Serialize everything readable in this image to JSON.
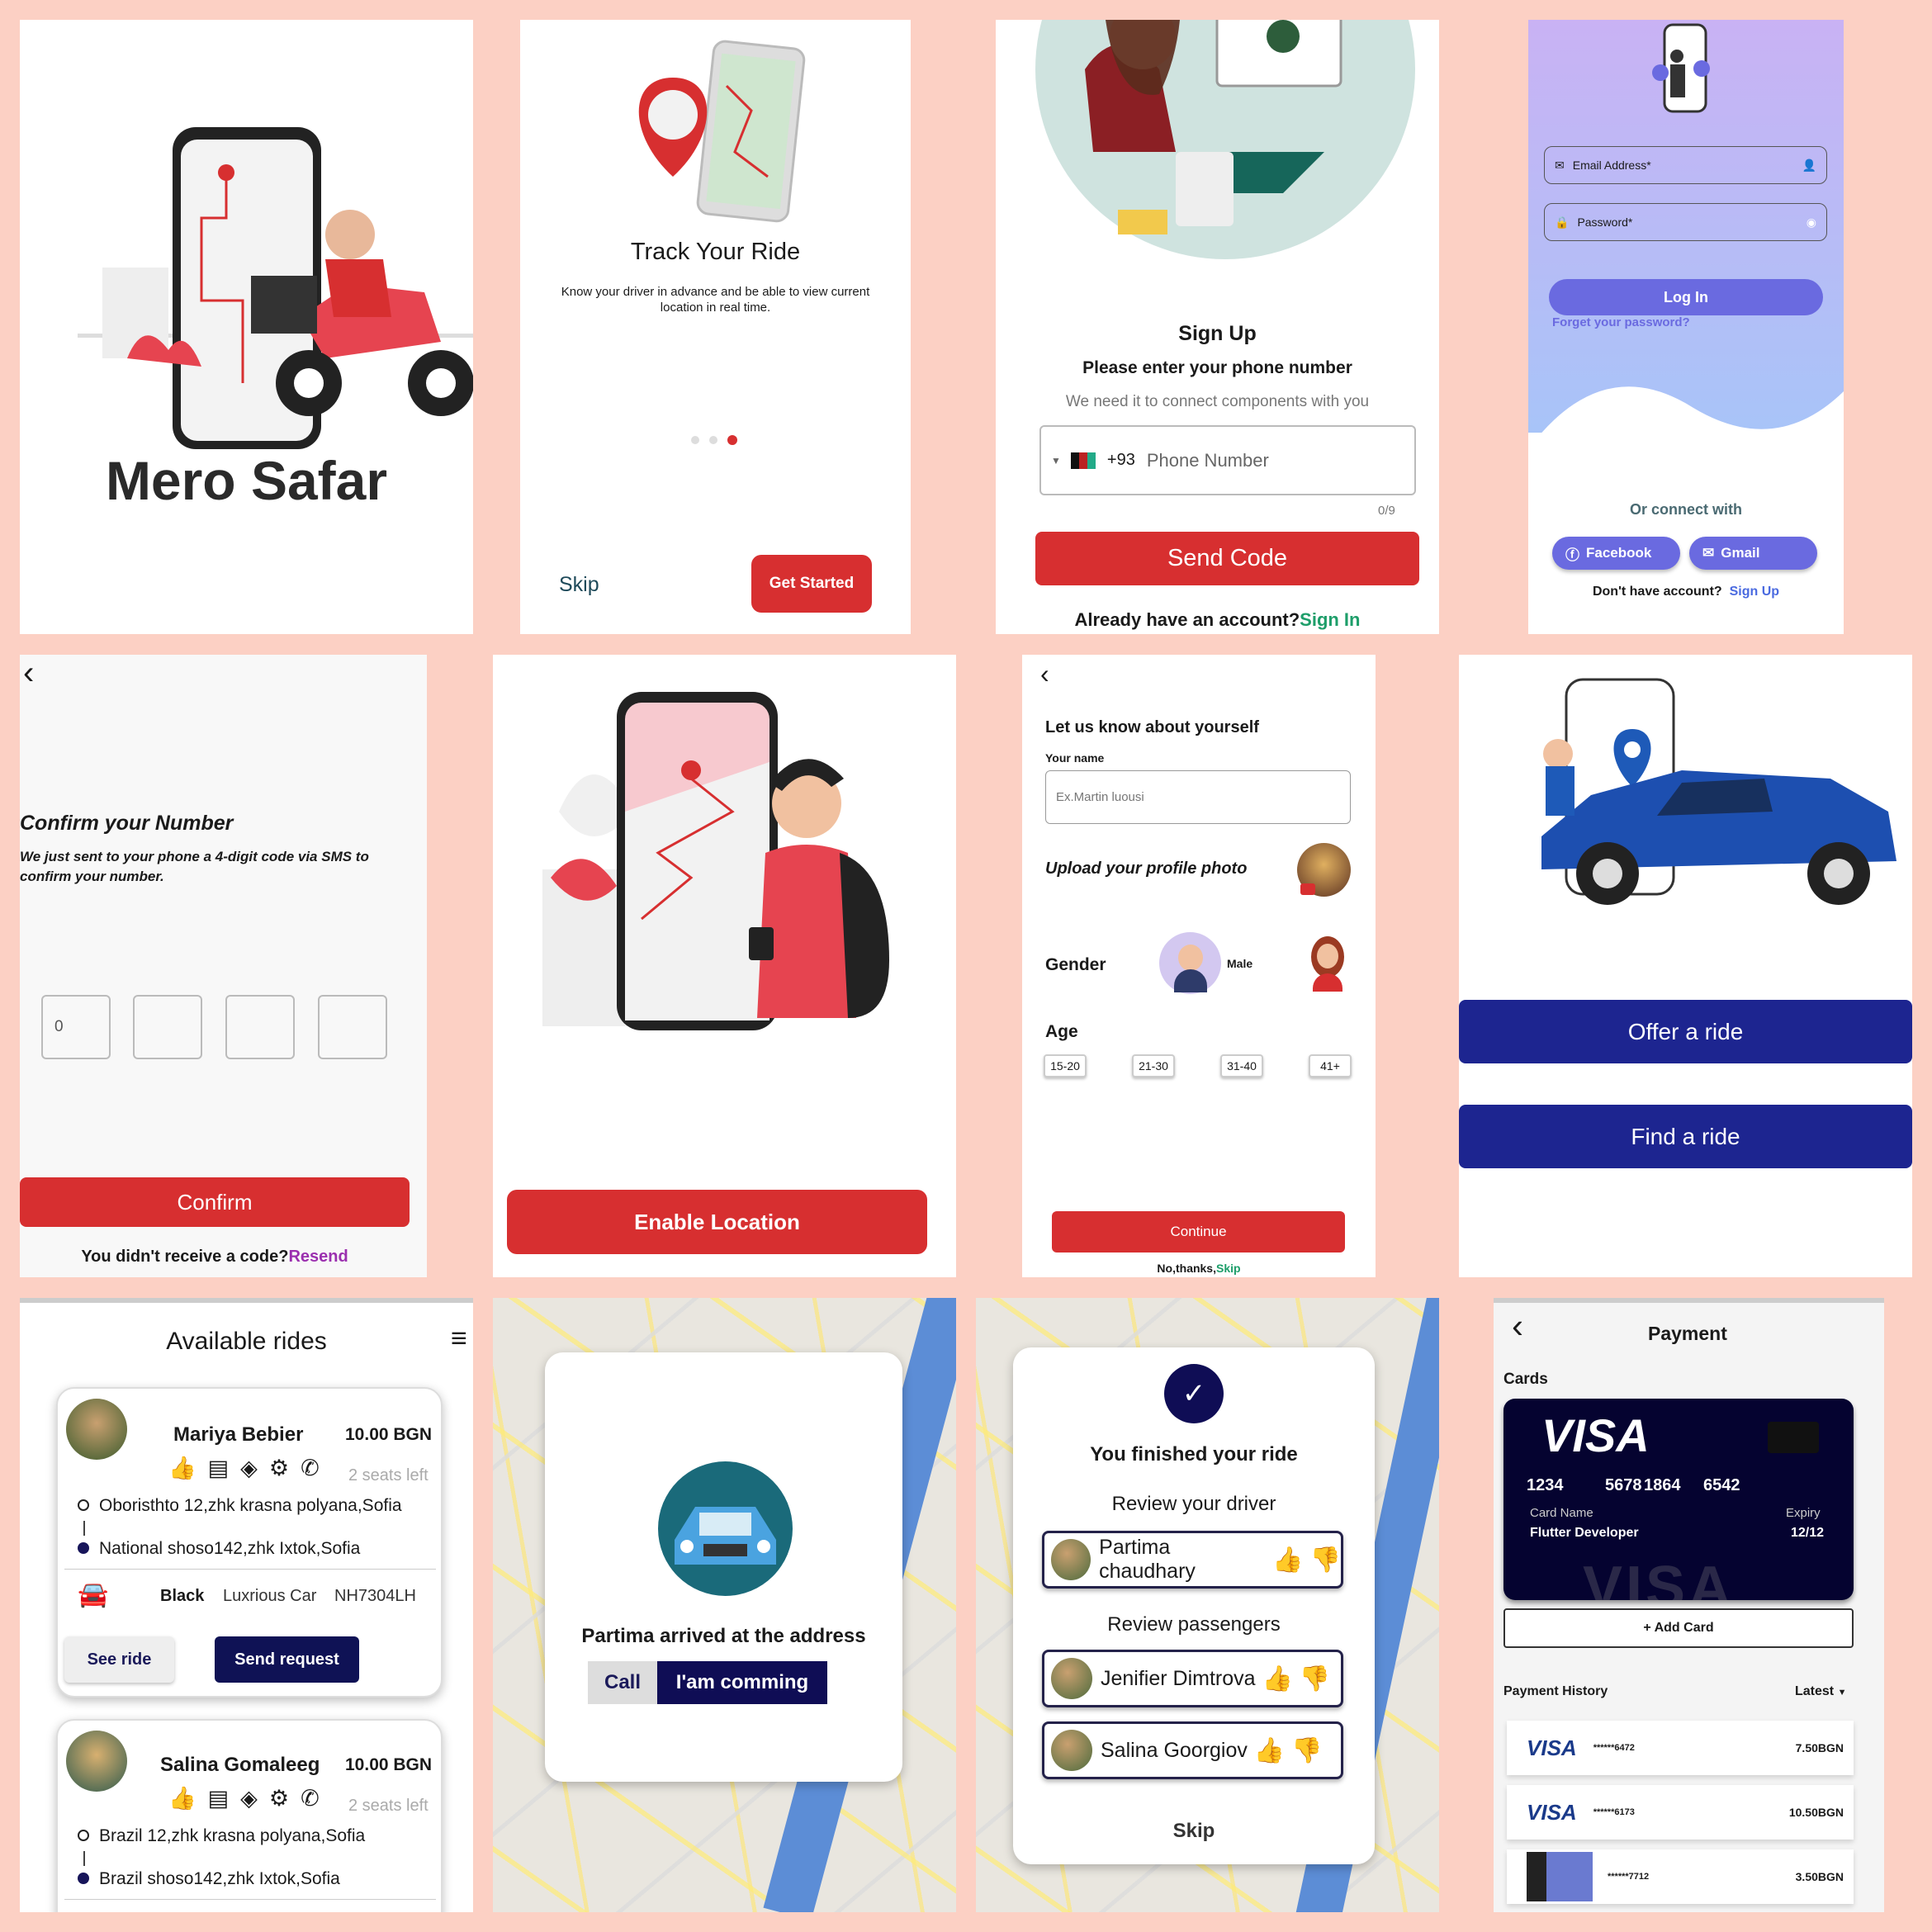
{
  "s1": {
    "title": "Mero Safar"
  },
  "s2": {
    "title": "Track Your Ride",
    "desc": "Know your driver in advance and be able to view current location in real time.",
    "skip": "Skip",
    "get_started": "Get Started"
  },
  "s3": {
    "title": "Sign Up",
    "subtitle": "Please enter your phone number",
    "hint": "We need it to connect components with you",
    "code": "+93",
    "placeholder": "Phone Number",
    "counter": "0/9",
    "send": "Send Code",
    "have_account": "Already have an account?",
    "sign_in": "Sign In"
  },
  "s4": {
    "email": "Email Address*",
    "password": "Password*",
    "login": "Log In",
    "forgot": "Forget your password?",
    "or": "Or connect with",
    "facebook": "Facebook",
    "gmail": "Gmail",
    "no_account": "Don't have account?",
    "signup": "Sign Up"
  },
  "s5": {
    "back": "‹",
    "title": "Confirm your Number",
    "desc": "We just sent to your phone a 4-digit code via SMS to confirm your number.",
    "digit1": "0",
    "confirm": "Confirm",
    "no_code": "You didn't receive a code?",
    "resend": "Resend"
  },
  "s6": {
    "enable": "Enable Location"
  },
  "s7": {
    "back": "‹",
    "title": "Let us know about yourself",
    "name_label": "Your name",
    "name_placeholder": "Ex.Martin luousi",
    "upload": "Upload your profile photo",
    "gender": "Gender",
    "male": "Male",
    "age": "Age",
    "ages": [
      "15-20",
      "21-30",
      "31-40",
      "41+"
    ],
    "continue": "Continue",
    "no_thanks": "No,thanks,",
    "skip": "Skip"
  },
  "s8": {
    "offer": "Offer a ride",
    "find": "Find a ride"
  },
  "s9": {
    "title": "Available rides",
    "menu": "≡",
    "rides": [
      {
        "name": "Mariya Bebier",
        "price": "10.00 BGN",
        "seats": "2 seats left",
        "from": "Oboristhto 12,zhk krasna polyana,Sofia",
        "to": "National shoso142,zhk Ixtok,Sofia",
        "color": "Black",
        "type": "Luxrious Car",
        "plate": "NH7304LH",
        "see": "See ride",
        "send": "Send request"
      },
      {
        "name": "Salina Gomaleeg",
        "price": "10.00 BGN",
        "seats": "2 seats left",
        "from": "Brazil 12,zhk krasna polyana,Sofia",
        "to": "Brazil shoso142,zhk Ixtok,Sofia"
      }
    ]
  },
  "s10": {
    "msg": "Partima arrived at the address",
    "call": "Call",
    "coming": "I'am comming"
  },
  "s11": {
    "check": "✓",
    "title": "You finished your ride",
    "review_driver": "Review your driver",
    "driver": "Partima chaudhary",
    "review_pass": "Review passengers",
    "p1": "Jenifier Dimtrova",
    "p2": "Salina Goorgiov",
    "skip": "Skip"
  },
  "s12": {
    "back": "‹",
    "title": "Payment",
    "cards": "Cards",
    "visa": "VISA",
    "n1": "1234",
    "n2": "5678",
    "n3": "1864",
    "n4": "6542",
    "card_name_label": "Card Name",
    "card_name": "Flutter Developer",
    "expiry_label": "Expiry",
    "expiry": "12/12",
    "add": "+ Add Card",
    "history": "Payment History",
    "latest": "Latest",
    "rows": [
      {
        "num": "******6472",
        "amt": "7.50BGN"
      },
      {
        "num": "******6173",
        "amt": "10.50BGN"
      },
      {
        "num": "******7712",
        "amt": "3.50BGN"
      }
    ]
  },
  "colors": {
    "red": "#d72f30",
    "navy": "#1d2590",
    "purple": "#6a6ae0",
    "bg": "#fcd0c4"
  }
}
